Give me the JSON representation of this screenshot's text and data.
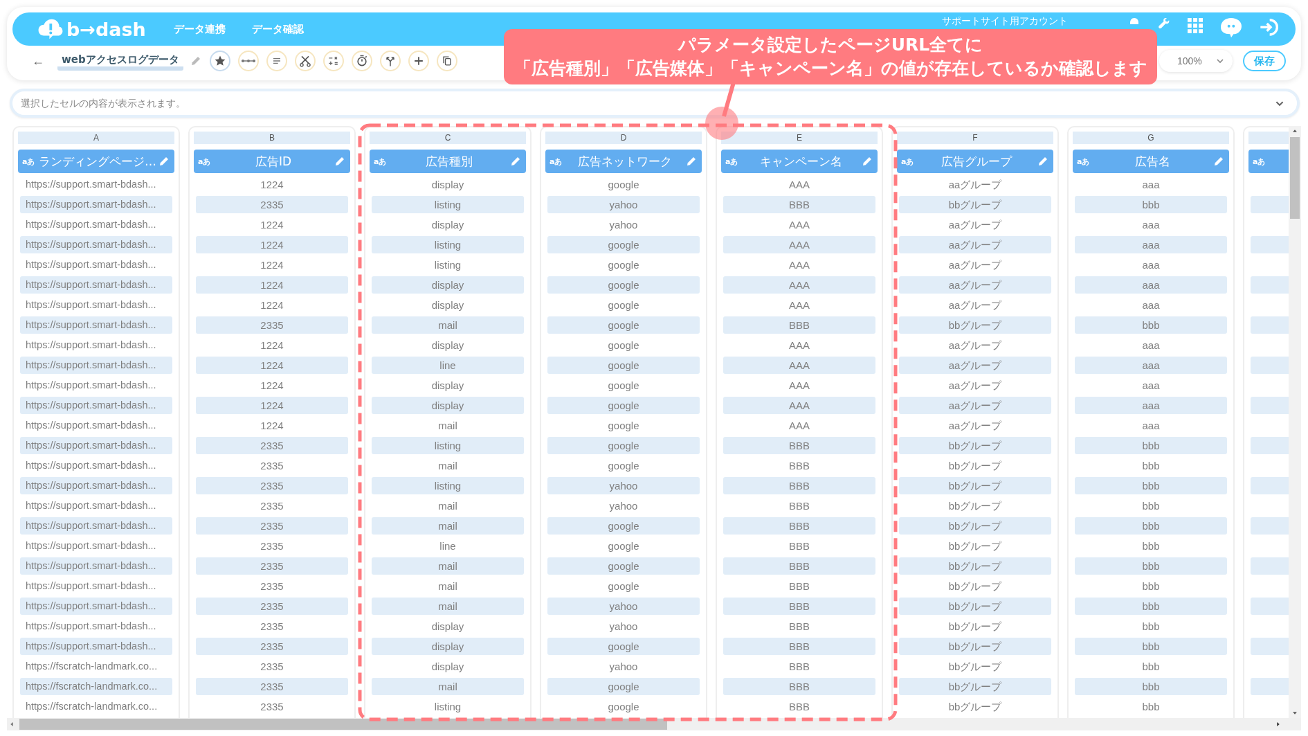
{
  "header": {
    "logo": "b→dash",
    "nav": [
      "データ連携",
      "データ確認"
    ],
    "account": "サポートサイト用アカウント"
  },
  "toolbar": {
    "back": "←",
    "title": "webアクセスログデータ",
    "zoom": "100%",
    "save": "保存"
  },
  "cell_viewer": {
    "placeholder": "選択したセルの内容が表示されます。"
  },
  "columns": [
    {
      "letter": "A",
      "type_icon": "aあ",
      "name": "ランディングページ…"
    },
    {
      "letter": "B",
      "type_icon": "aあ",
      "name": "広告ID"
    },
    {
      "letter": "C",
      "type_icon": "aあ",
      "name": "広告種別"
    },
    {
      "letter": "D",
      "type_icon": "aあ",
      "name": "広告ネットワーク"
    },
    {
      "letter": "E",
      "type_icon": "aあ",
      "name": "キャンペーン名"
    },
    {
      "letter": "F",
      "type_icon": "aあ",
      "name": "広告グループ"
    },
    {
      "letter": "G",
      "type_icon": "aあ",
      "name": "広告名"
    },
    {
      "type_icon": "aあ"
    }
  ],
  "rows": [
    [
      "https://support.smart-bdash...",
      "1224",
      "display",
      "google",
      "AAA",
      "aaグループ",
      "aaa"
    ],
    [
      "https://support.smart-bdash...",
      "2335",
      "listing",
      "yahoo",
      "BBB",
      "bbグループ",
      "bbb"
    ],
    [
      "https://support.smart-bdash...",
      "1224",
      "display",
      "yahoo",
      "AAA",
      "aaグループ",
      "aaa"
    ],
    [
      "https://support.smart-bdash...",
      "1224",
      "listing",
      "google",
      "AAA",
      "aaグループ",
      "aaa"
    ],
    [
      "https://support.smart-bdash...",
      "1224",
      "listing",
      "google",
      "AAA",
      "aaグループ",
      "aaa"
    ],
    [
      "https://support.smart-bdash...",
      "1224",
      "display",
      "google",
      "AAA",
      "aaグループ",
      "aaa"
    ],
    [
      "https://support.smart-bdash...",
      "1224",
      "display",
      "google",
      "AAA",
      "aaグループ",
      "aaa"
    ],
    [
      "https://support.smart-bdash...",
      "2335",
      "mail",
      "google",
      "BBB",
      "bbグループ",
      "bbb"
    ],
    [
      "https://support.smart-bdash...",
      "1224",
      "display",
      "google",
      "AAA",
      "aaグループ",
      "aaa"
    ],
    [
      "https://support.smart-bdash...",
      "1224",
      "line",
      "google",
      "AAA",
      "aaグループ",
      "aaa"
    ],
    [
      "https://support.smart-bdash...",
      "1224",
      "display",
      "google",
      "AAA",
      "aaグループ",
      "aaa"
    ],
    [
      "https://support.smart-bdash...",
      "1224",
      "display",
      "google",
      "AAA",
      "aaグループ",
      "aaa"
    ],
    [
      "https://support.smart-bdash...",
      "1224",
      "mail",
      "google",
      "AAA",
      "aaグループ",
      "aaa"
    ],
    [
      "https://support.smart-bdash...",
      "2335",
      "listing",
      "google",
      "BBB",
      "bbグループ",
      "bbb"
    ],
    [
      "https://support.smart-bdash...",
      "2335",
      "mail",
      "google",
      "BBB",
      "bbグループ",
      "bbb"
    ],
    [
      "https://support.smart-bdash...",
      "2335",
      "listing",
      "yahoo",
      "BBB",
      "bbグループ",
      "bbb"
    ],
    [
      "https://support.smart-bdash...",
      "2335",
      "mail",
      "yahoo",
      "BBB",
      "bbグループ",
      "bbb"
    ],
    [
      "https://support.smart-bdash...",
      "2335",
      "mail",
      "google",
      "BBB",
      "bbグループ",
      "bbb"
    ],
    [
      "https://support.smart-bdash...",
      "2335",
      "line",
      "google",
      "BBB",
      "bbグループ",
      "bbb"
    ],
    [
      "https://support.smart-bdash...",
      "2335",
      "mail",
      "google",
      "BBB",
      "bbグループ",
      "bbb"
    ],
    [
      "https://support.smart-bdash...",
      "2335",
      "mail",
      "google",
      "BBB",
      "bbグループ",
      "bbb"
    ],
    [
      "https://support.smart-bdash...",
      "2335",
      "mail",
      "yahoo",
      "BBB",
      "bbグループ",
      "bbb"
    ],
    [
      "https://support.smart-bdash...",
      "2335",
      "display",
      "yahoo",
      "BBB",
      "bbグループ",
      "bbb"
    ],
    [
      "https://support.smart-bdash...",
      "2335",
      "display",
      "google",
      "BBB",
      "bbグループ",
      "bbb"
    ],
    [
      "https://fscratch-landmark.co...",
      "2335",
      "display",
      "yahoo",
      "BBB",
      "bbグループ",
      "bbb"
    ],
    [
      "https://fscratch-landmark.co...",
      "2335",
      "mail",
      "google",
      "BBB",
      "bbグループ",
      "bbb"
    ],
    [
      "https://fscratch-landmark.co...",
      "2335",
      "listing",
      "google",
      "BBB",
      "bbグループ",
      "bbb"
    ]
  ],
  "callout": {
    "lines": [
      "パラメータ設定したページURL全てに",
      "「広告種別」「広告媒体」「キャンペーン名」の値が存在しているか確認します"
    ]
  }
}
